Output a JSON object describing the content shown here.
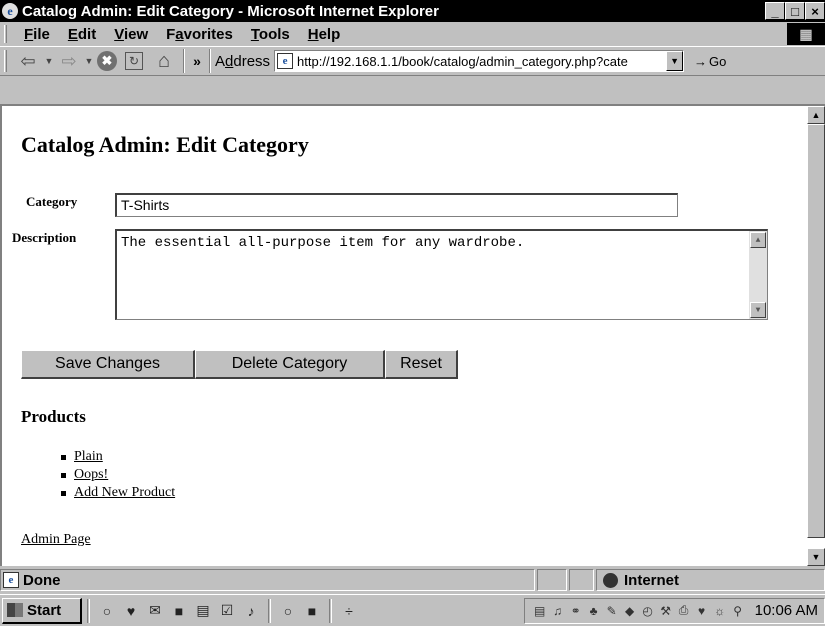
{
  "window": {
    "title": "Catalog Admin: Edit Category - Microsoft Internet Explorer",
    "min": "_",
    "max": "□",
    "close": "×"
  },
  "menubar": {
    "items": [
      {
        "label": "File",
        "accel": "F",
        "rest": "ile"
      },
      {
        "label": "Edit",
        "accel": "E",
        "rest": "dit"
      },
      {
        "label": "View",
        "accel": "V",
        "rest": "iew"
      },
      {
        "label": "Favorites",
        "pre": "F",
        "accel": "a",
        "rest": "vorites"
      },
      {
        "label": "Tools",
        "accel": "T",
        "rest": "ools"
      },
      {
        "label": "Help",
        "accel": "H",
        "rest": "elp"
      }
    ]
  },
  "toolbar": {
    "back_icon": "⇦",
    "forward_icon": "⇨",
    "drop_icon": "▼",
    "stop_icon": "✖",
    "refresh_icon": "↻",
    "home_icon": "⌂",
    "more_icon": "»",
    "address_label": "Address",
    "address_pre": "A",
    "address_accel": "d",
    "address_rest": "dress",
    "url": "http://192.168.1.1/book/catalog/admin_category.php?cate",
    "go_label": "Go",
    "go_icon": "→"
  },
  "page": {
    "heading": "Catalog Admin: Edit Category",
    "category_label": "Category",
    "category_value": "T-Shirts",
    "description_label": "Description",
    "description_value": "The essential all-purpose item for any wardrobe.",
    "buttons": {
      "save": "Save Changes",
      "delete": "Delete Category",
      "reset": "Reset"
    },
    "products_heading": "Products",
    "products": [
      "Plain",
      "Oops!",
      "Add New Product"
    ],
    "admin_link": "Admin Page"
  },
  "statusbar": {
    "status": "Done",
    "zone": "Internet"
  },
  "taskbar": {
    "start": "Start",
    "clock": "10:06 AM"
  }
}
